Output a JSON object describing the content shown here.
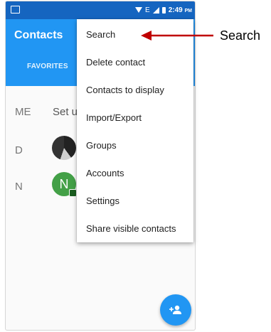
{
  "status_bar": {
    "network": "E",
    "time": "2:49",
    "ampm": "PM"
  },
  "app_bar": {
    "title": "Contacts",
    "tab_favorites": "FAVORITES"
  },
  "contacts": {
    "me_letter": "ME",
    "me_text": "Set u",
    "rows": [
      {
        "letter": "D"
      },
      {
        "letter": "N",
        "initial": "N"
      }
    ]
  },
  "menu": {
    "items": [
      {
        "label": "Search"
      },
      {
        "label": "Delete contact"
      },
      {
        "label": "Contacts to display"
      },
      {
        "label": "Import/Export"
      },
      {
        "label": "Groups"
      },
      {
        "label": "Accounts"
      },
      {
        "label": "Settings"
      },
      {
        "label": "Share visible contacts"
      }
    ]
  },
  "annotation": {
    "label": "Search",
    "color": "#c00000"
  },
  "colors": {
    "primary": "#2196f3",
    "primary_dark": "#1565c0",
    "avatar_green": "#43a047"
  },
  "icons": {
    "fab": "add-contact-icon",
    "status_left": "screenshot-icon"
  }
}
